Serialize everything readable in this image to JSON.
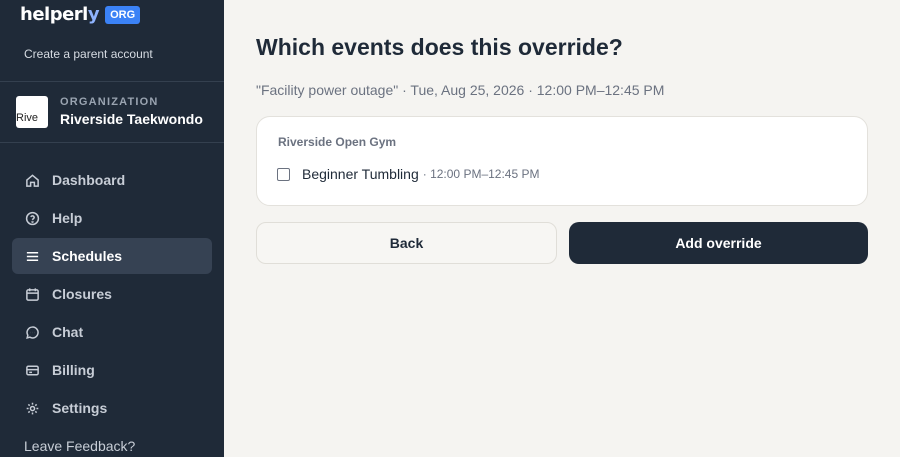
{
  "brand": {
    "logo_main": "helperl",
    "logo_accent": "y",
    "badge": "ORG"
  },
  "sidebar": {
    "create_parent": "Create a parent account",
    "org_eyebrow": "ORGANIZATION",
    "org_name": "Riverside Taekwondo",
    "org_avatar_alt": "Rive",
    "items": [
      {
        "label": "Dashboard",
        "icon": "home-icon"
      },
      {
        "label": "Help",
        "icon": "help-icon"
      },
      {
        "label": "Schedules",
        "icon": "list-icon",
        "active": true
      },
      {
        "label": "Closures",
        "icon": "calendar-icon"
      },
      {
        "label": "Chat",
        "icon": "chat-icon"
      },
      {
        "label": "Billing",
        "icon": "billing-icon"
      },
      {
        "label": "Settings",
        "icon": "gear-icon"
      }
    ],
    "leave_feedback": "Leave Feedback?"
  },
  "main": {
    "title": "Which events does this override?",
    "subtitle": "\"Facility power outage\" · Tue, Aug 25, 2026 · 12:00 PM–12:45 PM",
    "group_label": "Riverside Open Gym",
    "event_name": "Beginner Tumbling",
    "event_time": "· 12:00 PM–12:45 PM",
    "event_checked": false,
    "back_label": "Back",
    "add_label": "Add override"
  },
  "colors": {
    "sidebar_bg": "#1f2a38",
    "accent": "#3b82f6",
    "page_bg": "#f5f4f1"
  }
}
